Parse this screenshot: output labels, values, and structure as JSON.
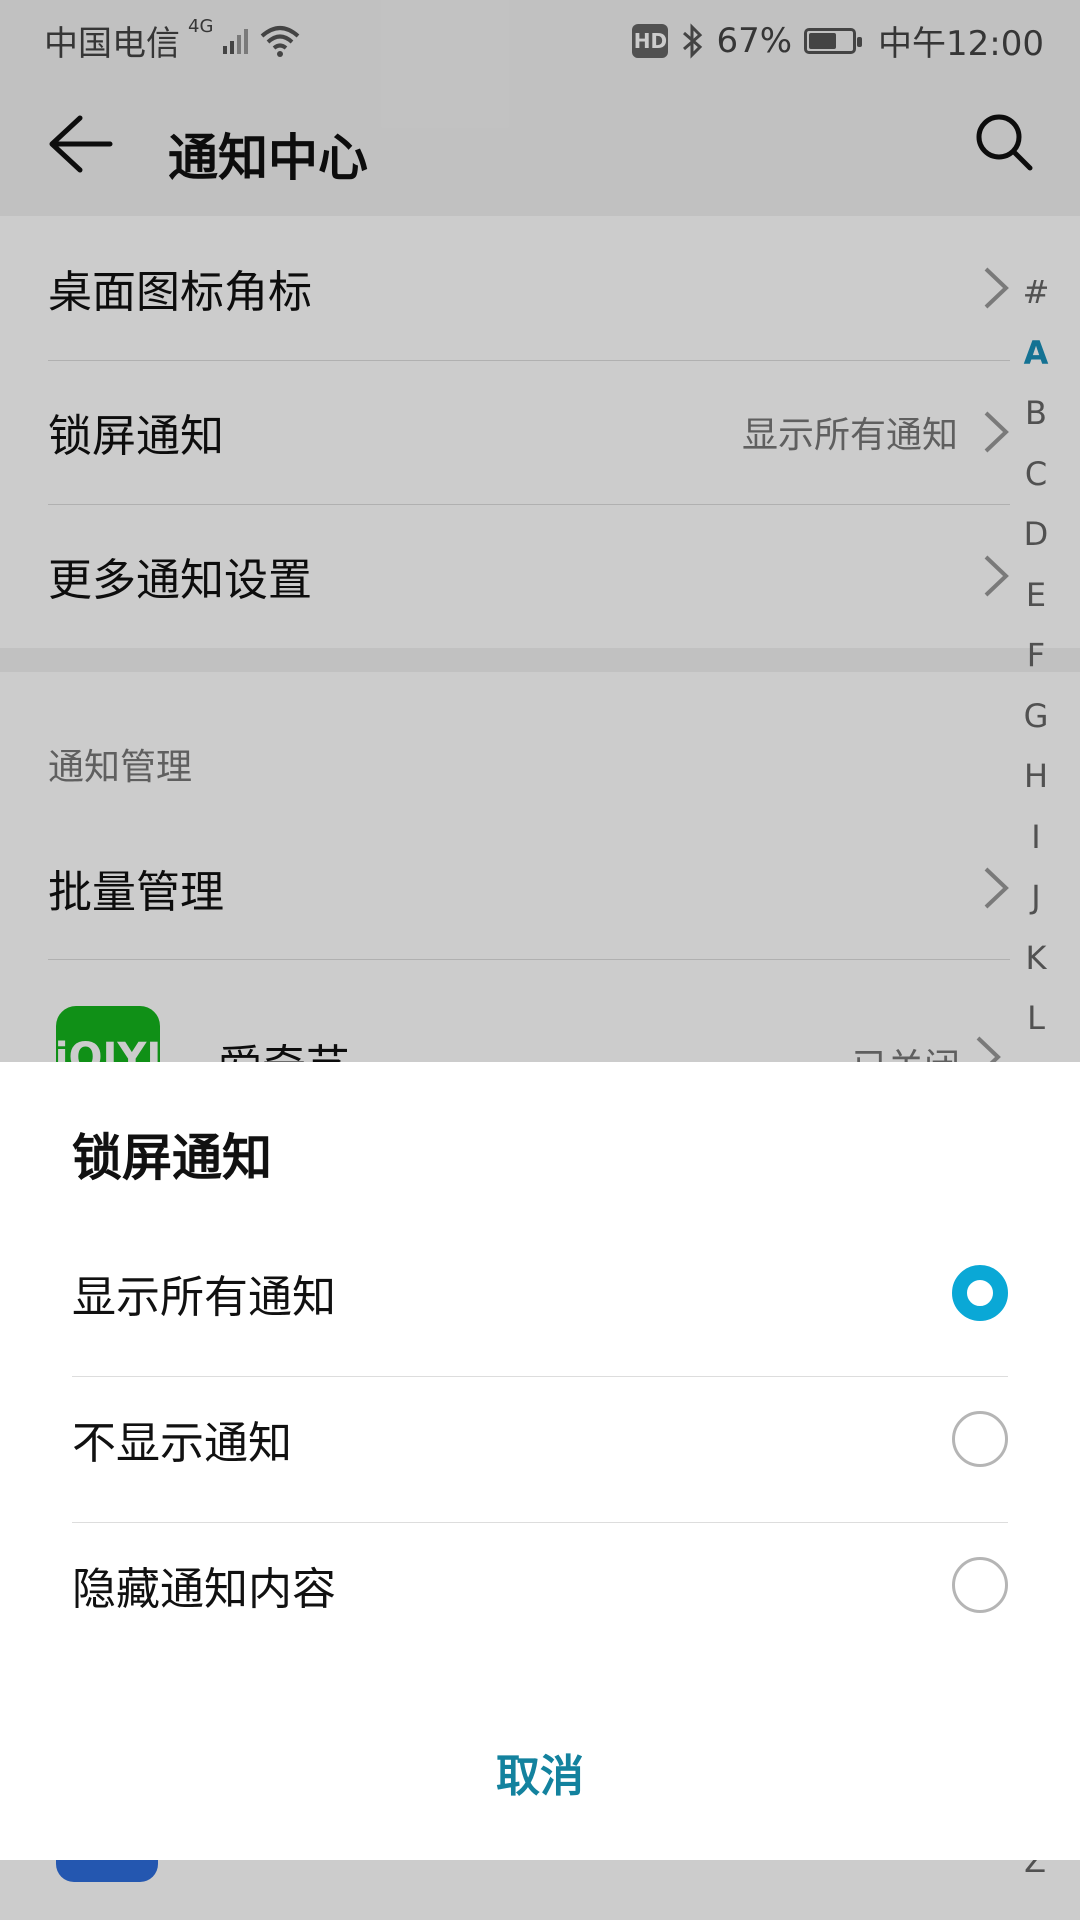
{
  "status_bar": {
    "carrier": "中国电信",
    "network": "4G",
    "battery_percent": "67%",
    "battery_level": 0.67,
    "time": "中午12:00",
    "hd_label": "HD"
  },
  "header": {
    "title": "通知中心"
  },
  "settings": [
    {
      "label": "桌面图标角标",
      "value": ""
    },
    {
      "label": "锁屏通知",
      "value": "显示所有通知"
    },
    {
      "label": "更多通知设置",
      "value": ""
    }
  ],
  "management": {
    "section_title": "通知管理",
    "batch_label": "批量管理",
    "app": {
      "icon_text": "iQIYI",
      "name": "爱奇艺",
      "status": "已关闭"
    }
  },
  "alphabet_index": [
    "#",
    "A",
    "B",
    "C",
    "D",
    "E",
    "F",
    "G",
    "H",
    "I",
    "J",
    "K",
    "L"
  ],
  "alphabet_active": "A",
  "alphabet_last": "Z",
  "dialog": {
    "title": "锁屏通知",
    "options": [
      {
        "label": "显示所有通知",
        "selected": true
      },
      {
        "label": "不显示通知",
        "selected": false
      },
      {
        "label": "隐藏通知内容",
        "selected": false
      }
    ],
    "cancel_label": "取消"
  },
  "colors": {
    "accent": "#0aa8d6",
    "cancel_text": "#13829e",
    "app_icon": "#15b51d"
  }
}
